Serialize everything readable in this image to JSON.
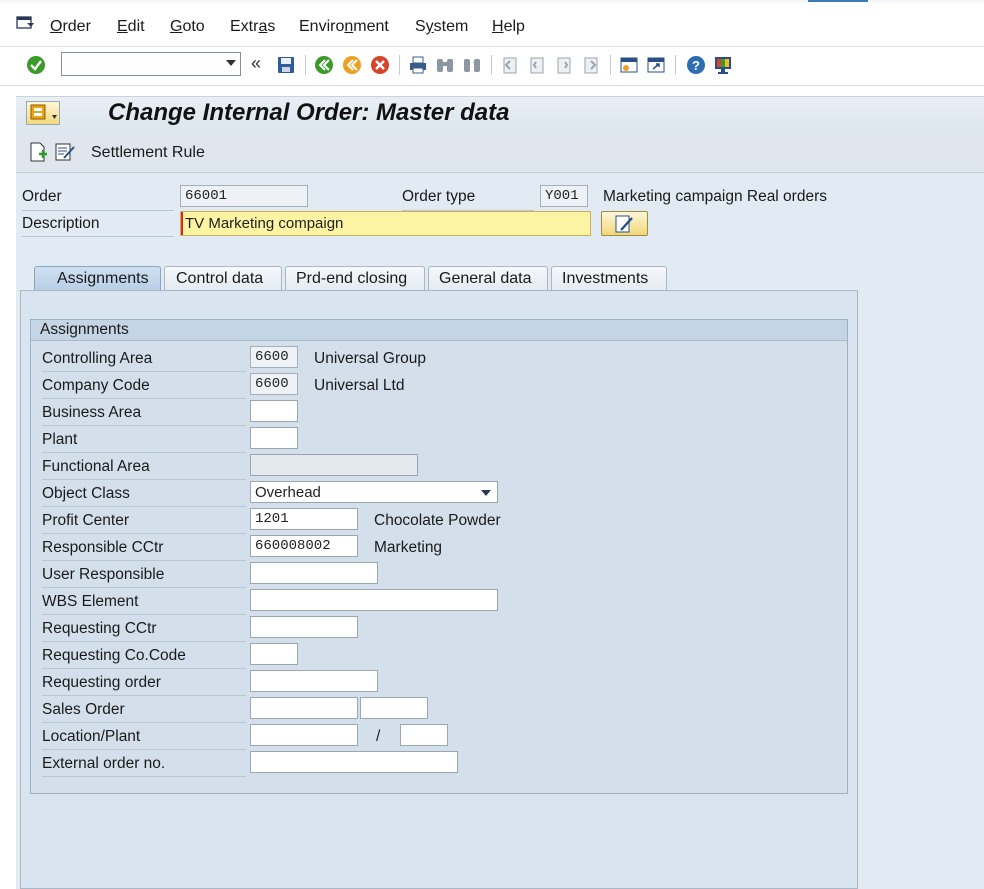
{
  "menu": {
    "items": [
      "Order",
      "Edit",
      "Goto",
      "Extras",
      "Environment",
      "System",
      "Help"
    ],
    "accelerators": [
      "O",
      "E",
      "G",
      "a",
      "n",
      "y",
      "H"
    ]
  },
  "toolbar": {
    "command_value": "",
    "back_double": "«"
  },
  "title": "Change Internal Order: Master data",
  "app_toolbar": {
    "settlement_rule": "Settlement Rule"
  },
  "header": {
    "order_label": "Order",
    "order_value": "66001",
    "order_type_label": "Order type",
    "order_type_value": "Y001",
    "order_type_text": "Marketing campaign Real orders",
    "description_label": "Description",
    "description_value": "TV Marketing compaign"
  },
  "tabs": [
    "Assignments",
    "Control data",
    "Prd-end closing",
    "General data",
    "Investments"
  ],
  "assignments": {
    "group_title": "Assignments",
    "rows": [
      {
        "label": "Controlling Area",
        "value": "6600",
        "text": "Universal Group"
      },
      {
        "label": "Company Code",
        "value": "6600",
        "text": "Universal Ltd"
      },
      {
        "label": "Business Area",
        "value": "",
        "text": ""
      },
      {
        "label": "Plant",
        "value": "",
        "text": ""
      },
      {
        "label": "Functional Area",
        "value": "",
        "text": ""
      },
      {
        "label": "Object Class",
        "value": "Overhead",
        "text": ""
      },
      {
        "label": "Profit Center",
        "value": "1201",
        "text": "Chocolate Powder"
      },
      {
        "label": "Responsible CCtr",
        "value": "660008002",
        "text": "Marketing"
      },
      {
        "label": "User Responsible",
        "value": "",
        "text": ""
      },
      {
        "label": "WBS Element",
        "value": "",
        "text": ""
      },
      {
        "label": "Requesting CCtr",
        "value": "",
        "text": ""
      },
      {
        "label": "Requesting Co.Code",
        "value": "",
        "text": ""
      },
      {
        "label": "Requesting order",
        "value": "",
        "text": ""
      },
      {
        "label": "Sales Order",
        "value": "",
        "text": ""
      },
      {
        "label": "Location/Plant",
        "value": "",
        "text": "/"
      },
      {
        "label": "External order no.",
        "value": "",
        "text": ""
      }
    ]
  },
  "colors": {
    "description_bg": "#fcf4a3",
    "accent_green": "#3a9a2a",
    "accent_orange": "#f0a020",
    "accent_red": "#d8432a"
  },
  "icons": {
    "menu": "menu-icon",
    "enter": "enter-check-icon",
    "save": "save-icon",
    "back": "back-icon",
    "exit": "exit-icon",
    "cancel": "cancel-icon",
    "print": "print-icon",
    "find": "find-icon",
    "find_next": "find-next-icon",
    "first_page": "first-page-icon",
    "prev_page": "prev-page-icon",
    "next_page": "next-page-icon",
    "last_page": "last-page-icon",
    "new_session": "new-session-icon",
    "shortcut": "create-shortcut-icon",
    "help": "help-icon",
    "layout": "customize-layout-icon"
  }
}
